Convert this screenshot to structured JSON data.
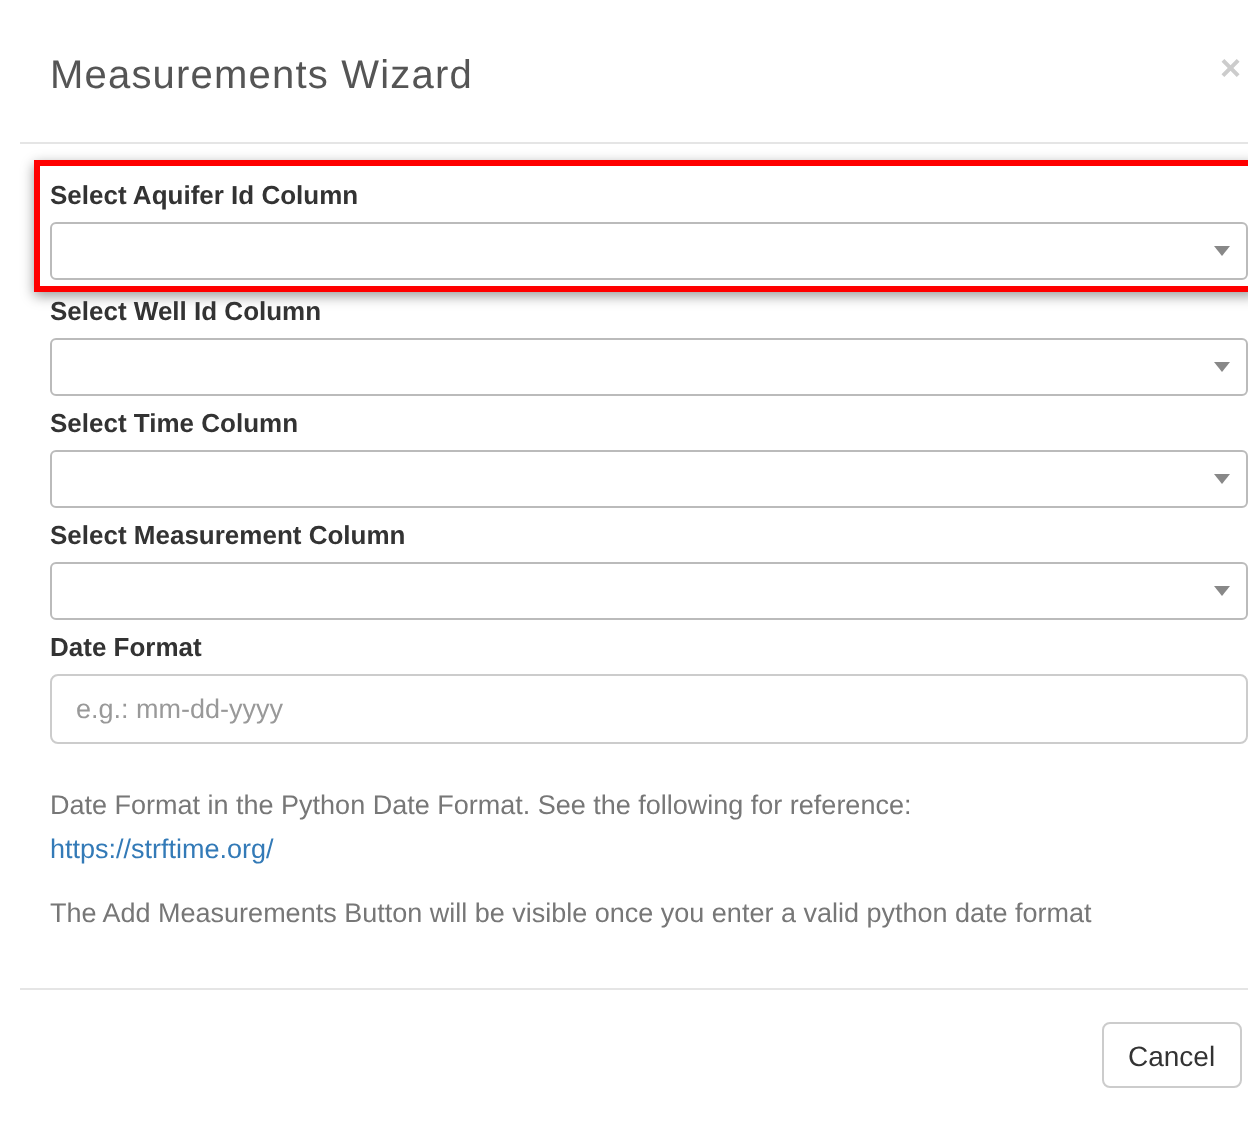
{
  "dialog": {
    "title": "Measurements Wizard",
    "close": "×"
  },
  "fields": [
    {
      "label": "Select Aquifer Id Column",
      "kind": "select",
      "highlighted": true
    },
    {
      "label": "Select Well Id Column",
      "kind": "select",
      "highlighted": false
    },
    {
      "label": "Select Time Column",
      "kind": "select",
      "highlighted": false
    },
    {
      "label": "Select Measurement Column",
      "kind": "select",
      "highlighted": false
    },
    {
      "label": "Date Format",
      "kind": "text",
      "placeholder": "e.g.: mm-dd-yyyy",
      "highlighted": false
    }
  ],
  "help": {
    "text": "Date Format in the Python Date Format. See the following for reference:",
    "link": "https://strftime.org/"
  },
  "note": "The Add Measurements Button will be visible once you enter a valid python date format",
  "buttons": [
    "Cancel"
  ]
}
